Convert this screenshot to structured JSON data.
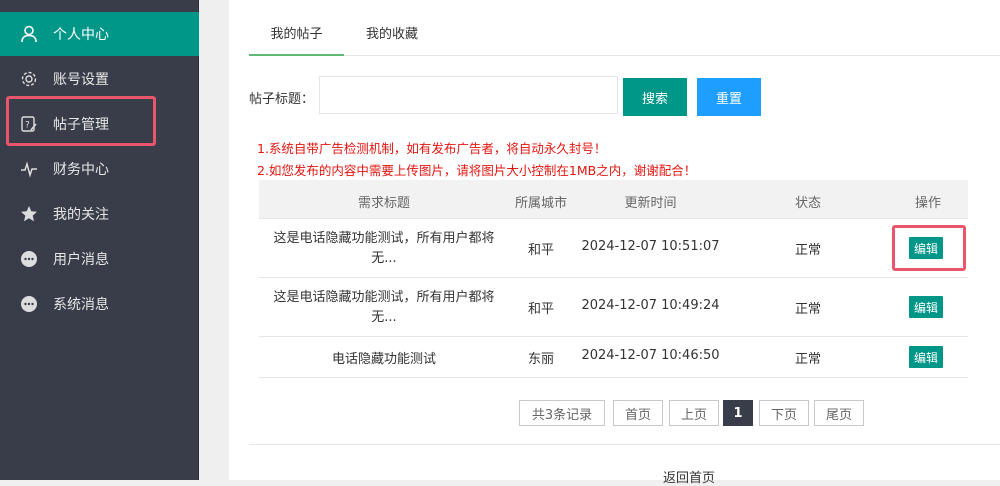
{
  "sidebar": {
    "items": [
      {
        "label": "个人中心",
        "icon": "user-icon"
      },
      {
        "label": "账号设置",
        "icon": "gear-icon"
      },
      {
        "label": "帖子管理",
        "icon": "post-edit-icon"
      },
      {
        "label": "财务中心",
        "icon": "pulse-icon"
      },
      {
        "label": "我的关注",
        "icon": "star-icon"
      },
      {
        "label": "用户消息",
        "icon": "chat-icon"
      },
      {
        "label": "系统消息",
        "icon": "chat-icon"
      }
    ]
  },
  "tabs": [
    {
      "label": "我的帖子"
    },
    {
      "label": "我的收藏"
    }
  ],
  "search": {
    "label": "帖子标题：",
    "value": "",
    "placeholder": "",
    "search_button": "搜索",
    "reset_button": "重置"
  },
  "notices": [
    "1.系统自带广告检测机制，如有发布广告者，将自动永久封号！",
    "2.如您发布的内容中需要上传图片，请将图片大小控制在1MB之内，谢谢配合！"
  ],
  "table": {
    "columns": [
      "需求标题",
      "所属城市",
      "更新时间",
      "状态",
      "操作"
    ],
    "rows": [
      {
        "title_line1": "这是电话隐藏功能测试，所有用户都将",
        "title_line2": "无...",
        "city": "和平",
        "time": "2024-12-07 10:51:07",
        "status": "正常",
        "action": "编辑"
      },
      {
        "title_line1": "这是电话隐藏功能测试，所有用户都将",
        "title_line2": "无...",
        "city": "和平",
        "time": "2024-12-07 10:49:24",
        "status": "正常",
        "action": "编辑"
      },
      {
        "title_line1": "电话隐藏功能测试",
        "title_line2": "",
        "city": "东丽",
        "time": "2024-12-07 10:46:50",
        "status": "正常",
        "action": "编辑"
      }
    ]
  },
  "pager": {
    "total": "共3条记录",
    "first": "首页",
    "prev": "上页",
    "current": "1",
    "next": "下页",
    "last": "尾页"
  },
  "footer": {
    "back_home": "返回首页"
  },
  "colors": {
    "sidebar_bg": "#393d49",
    "accent": "#009688",
    "reset_blue": "#1e9fff",
    "notice_red": "#e3150f",
    "status_blue": "#2a8bc6",
    "highlight": "#e9566b"
  }
}
